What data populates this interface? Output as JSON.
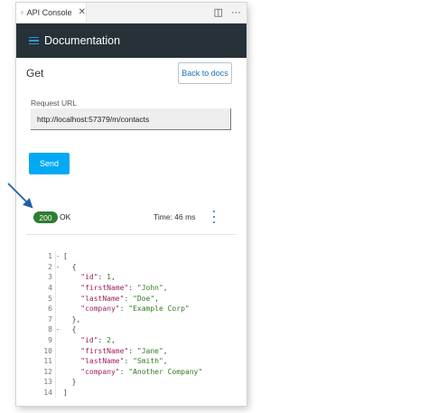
{
  "tab": {
    "title": "API Console",
    "close_glyph": "✕",
    "icon": "document-icon",
    "actions": [
      {
        "name": "split-editor-icon",
        "glyph": "◫"
      },
      {
        "name": "more-actions-icon",
        "glyph": "···"
      }
    ]
  },
  "header": {
    "title": "Documentation",
    "menu_icon": "hamburger-icon",
    "color": "#263238",
    "accent": "#2b9bd6"
  },
  "request": {
    "method": "Get",
    "back_label": "Back to docs",
    "url_label": "Request URL",
    "url_value": "http://localhost:57379/m/contacts",
    "send_label": "Send"
  },
  "response": {
    "status_code": "200",
    "status_text": "OK",
    "time": "Time: 46 ms",
    "status_color": "#2e7d32",
    "more_icon": "vertical-dots-icon"
  },
  "code_lines": [
    {
      "n": "1",
      "fold": "-",
      "tokens": [
        {
          "t": "p",
          "v": "["
        }
      ]
    },
    {
      "n": "2",
      "fold": "-",
      "tokens": [
        {
          "t": "p",
          "v": "  {"
        }
      ]
    },
    {
      "n": "3",
      "fold": "",
      "tokens": [
        {
          "t": "p",
          "v": "    "
        },
        {
          "t": "k",
          "v": "\"id\""
        },
        {
          "t": "p",
          "v": ": "
        },
        {
          "t": "n",
          "v": "1"
        },
        {
          "t": "p",
          "v": ","
        }
      ]
    },
    {
      "n": "4",
      "fold": "",
      "tokens": [
        {
          "t": "p",
          "v": "    "
        },
        {
          "t": "k",
          "v": "\"firstName\""
        },
        {
          "t": "p",
          "v": ": "
        },
        {
          "t": "s",
          "v": "\"John\""
        },
        {
          "t": "p",
          "v": ","
        }
      ]
    },
    {
      "n": "5",
      "fold": "",
      "tokens": [
        {
          "t": "p",
          "v": "    "
        },
        {
          "t": "k",
          "v": "\"lastName\""
        },
        {
          "t": "p",
          "v": ": "
        },
        {
          "t": "s",
          "v": "\"Doe\""
        },
        {
          "t": "p",
          "v": ","
        }
      ]
    },
    {
      "n": "6",
      "fold": "",
      "tokens": [
        {
          "t": "p",
          "v": "    "
        },
        {
          "t": "k",
          "v": "\"company\""
        },
        {
          "t": "p",
          "v": ": "
        },
        {
          "t": "s",
          "v": "\"Example Corp\""
        }
      ]
    },
    {
      "n": "7",
      "fold": "",
      "tokens": [
        {
          "t": "p",
          "v": "  },"
        }
      ]
    },
    {
      "n": "8",
      "fold": "-",
      "tokens": [
        {
          "t": "p",
          "v": "  {"
        }
      ]
    },
    {
      "n": "9",
      "fold": "",
      "tokens": [
        {
          "t": "p",
          "v": "    "
        },
        {
          "t": "k",
          "v": "\"id\""
        },
        {
          "t": "p",
          "v": ": "
        },
        {
          "t": "n",
          "v": "2"
        },
        {
          "t": "p",
          "v": ","
        }
      ]
    },
    {
      "n": "10",
      "fold": "",
      "tokens": [
        {
          "t": "p",
          "v": "    "
        },
        {
          "t": "k",
          "v": "\"firstName\""
        },
        {
          "t": "p",
          "v": ": "
        },
        {
          "t": "s",
          "v": "\"Jane\""
        },
        {
          "t": "p",
          "v": ","
        }
      ]
    },
    {
      "n": "11",
      "fold": "",
      "tokens": [
        {
          "t": "p",
          "v": "    "
        },
        {
          "t": "k",
          "v": "\"lastName\""
        },
        {
          "t": "p",
          "v": ": "
        },
        {
          "t": "s",
          "v": "\"Smith\""
        },
        {
          "t": "p",
          "v": ","
        }
      ]
    },
    {
      "n": "12",
      "fold": "",
      "tokens": [
        {
          "t": "p",
          "v": "    "
        },
        {
          "t": "k",
          "v": "\"company\""
        },
        {
          "t": "p",
          "v": ": "
        },
        {
          "t": "s",
          "v": "\"Another Company\""
        }
      ]
    },
    {
      "n": "13",
      "fold": "",
      "tokens": [
        {
          "t": "p",
          "v": "  }"
        }
      ]
    },
    {
      "n": "14",
      "fold": "",
      "tokens": [
        {
          "t": "p",
          "v": "]"
        }
      ]
    }
  ],
  "annotation": {
    "arrow_color": "#1f5fa3"
  }
}
